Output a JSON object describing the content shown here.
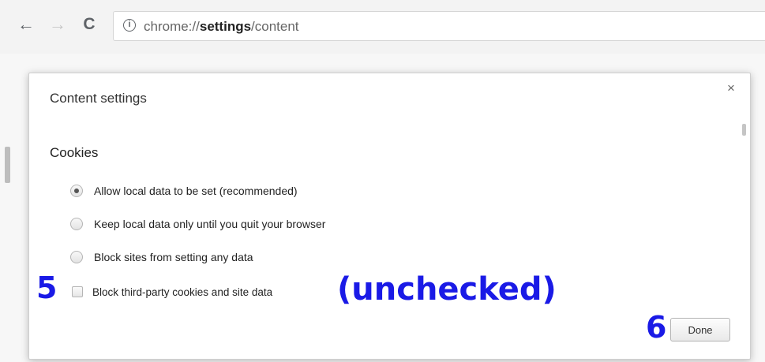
{
  "browser": {
    "url_prefix": "chrome://",
    "url_bold": "settings",
    "url_suffix": "/content",
    "back_glyph": "←",
    "forward_glyph": "→",
    "reload_glyph": "C",
    "info_glyph": "i"
  },
  "dialog": {
    "title": "Content settings",
    "close_glyph": "×",
    "section_title": "Cookies",
    "options": [
      {
        "label": "Allow local data to be set (recommended)",
        "type": "radio",
        "checked": true
      },
      {
        "label": "Keep local data only until you quit your browser",
        "type": "radio",
        "checked": false
      },
      {
        "label": "Block sites from setting any data",
        "type": "radio",
        "checked": false
      },
      {
        "label": "Block third-party cookies and site data",
        "type": "checkbox",
        "checked": false
      }
    ],
    "done_label": "Done"
  },
  "annotations": {
    "step_5": "5",
    "step_6": "6",
    "unchecked_note": "(unchecked)",
    "color": "#1a1ae6"
  }
}
